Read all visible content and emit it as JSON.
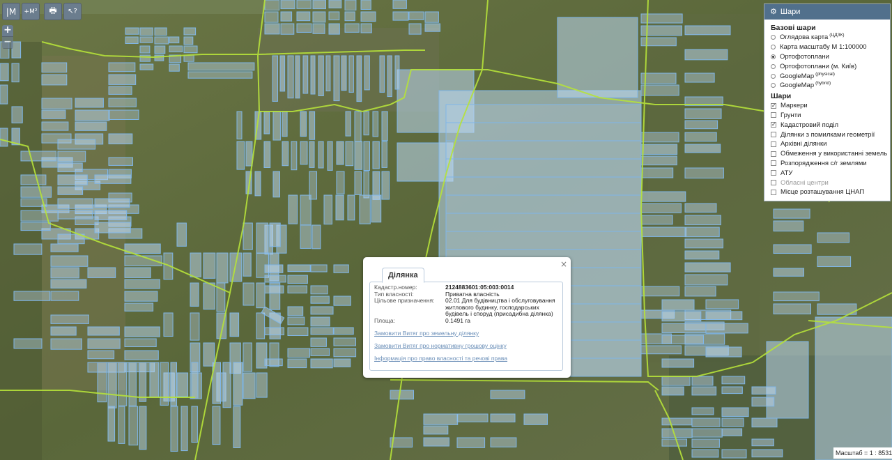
{
  "toolbar": {
    "buttons": [
      {
        "name": "measure-line-button",
        "label": "|M"
      },
      {
        "name": "measure-area-button",
        "label": "+M²"
      },
      {
        "name": "print-button",
        "label": "🖶"
      },
      {
        "name": "info-cursor-button",
        "label": "↖?"
      }
    ]
  },
  "zoom": {
    "in": "+",
    "out": "−"
  },
  "layers_panel": {
    "title": "Шари",
    "gear_icon": "gear-icon",
    "base_heading": "Базові шари",
    "base_layers": [
      {
        "label": "Оглядова карта",
        "sup": "(ЦДЗК)",
        "selected": false
      },
      {
        "label": "Карта масштабу М 1:100000",
        "sup": "",
        "selected": false
      },
      {
        "label": "Ортофотоплани",
        "sup": "",
        "selected": true
      },
      {
        "label": "Ортофотоплани (м. Київ)",
        "sup": "",
        "selected": false
      },
      {
        "label": "GoogleMap",
        "sup": "(physical)",
        "selected": false
      },
      {
        "label": "GoogleMap",
        "sup": "(hybrid)",
        "selected": false
      }
    ],
    "overlay_heading": "Шари",
    "overlays": [
      {
        "label": "Маркери",
        "checked": true,
        "disabled": false
      },
      {
        "label": "Грунти",
        "checked": false,
        "disabled": false
      },
      {
        "label": "Кадастровий поділ",
        "checked": true,
        "disabled": false
      },
      {
        "label": "Ділянки з помилками геометрії",
        "checked": false,
        "disabled": false
      },
      {
        "label": "Архівні ділянки",
        "checked": false,
        "disabled": false
      },
      {
        "label": "Обмеження у використанні земель",
        "checked": false,
        "disabled": false
      },
      {
        "label": "Розпорядження с/г землями",
        "checked": false,
        "disabled": false
      },
      {
        "label": "АТУ",
        "checked": false,
        "disabled": false
      },
      {
        "label": "Обласні центри",
        "checked": false,
        "disabled": true
      },
      {
        "label": "Місце розташування ЦНАП",
        "checked": false,
        "disabled": false
      }
    ]
  },
  "popup": {
    "tab": "Ділянка",
    "close": "×",
    "fields": [
      {
        "label": "Кадастр.номер:",
        "value": "2124883601:05:003:0014",
        "bold": true
      },
      {
        "label": "Тип власності:",
        "value": "Приватна власність",
        "bold": false
      },
      {
        "label": "Цільове призначення:",
        "value": "02.01 Для будівництва і обслуговування житлового будинку, господарських будівель і споруд (присадибна ділянка)",
        "bold": false
      },
      {
        "label": "Площа:",
        "value": "0.1491 га",
        "bold": false
      }
    ],
    "links": [
      "Замовити Витяг про земельну ділянку",
      "Замовити Витяг про нормативну грошову оцінку",
      "Інформація про право власності та речові права"
    ]
  },
  "scale": {
    "text": "Масштаб = 1 : 8531"
  },
  "colors": {
    "parcel_fill": "#bcd8f2",
    "parcel_stroke": "#7fb6e8",
    "boundary_line": "#b6e23a",
    "header_blue": "#51708c",
    "link_blue": "#6b8fb8"
  }
}
